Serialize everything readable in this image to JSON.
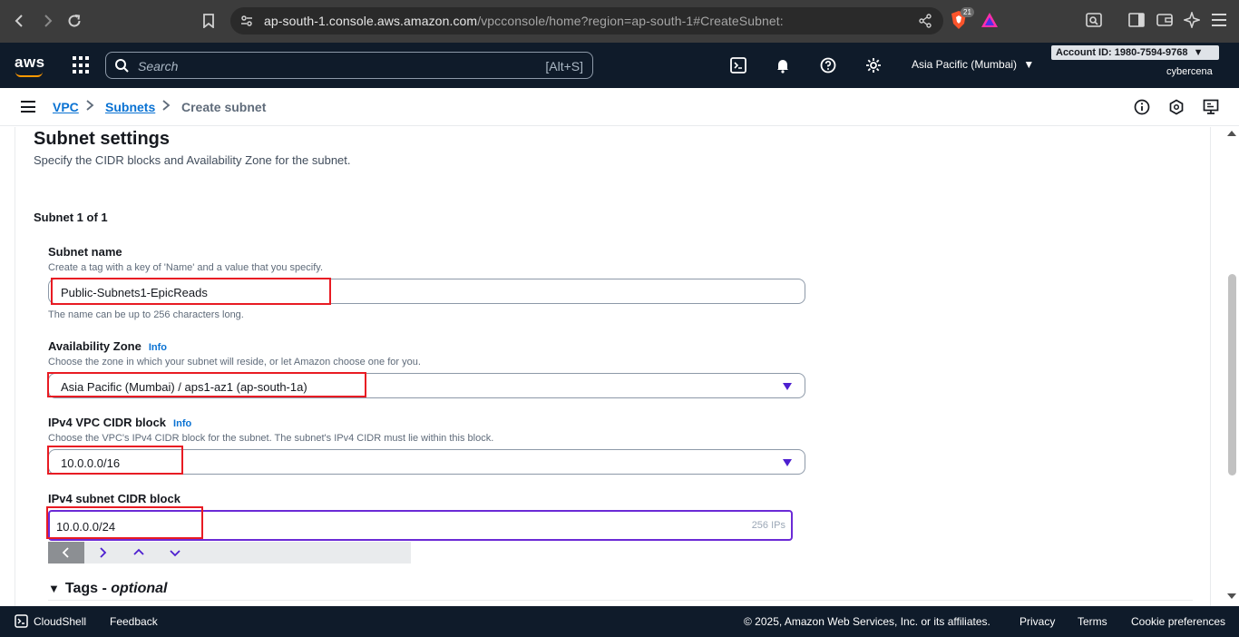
{
  "browser": {
    "url_main": "ap-south-1.console.aws.amazon.com",
    "url_rest": "/vpcconsole/home?region=ap-south-1#CreateSubnet:",
    "brave_badge": "21"
  },
  "aws_header": {
    "logo": "aws",
    "search_placeholder": "Search",
    "search_shortcut": "[Alt+S]",
    "region": "Asia Pacific (Mumbai)",
    "account_id": "Account ID: 1980-7594-9768",
    "username": "cybercena"
  },
  "breadcrumb": {
    "items": [
      "VPC",
      "Subnets"
    ],
    "current": "Create subnet"
  },
  "subnet_settings": {
    "title": "Subnet settings",
    "description": "Specify the CIDR blocks and Availability Zone for the subnet.",
    "subnet_count": "Subnet 1 of 1",
    "subnet_name": {
      "label": "Subnet name",
      "description": "Create a tag with a key of 'Name' and a value that you specify.",
      "value": "Public-Subnets1-EpicReads",
      "constraint": "The name can be up to 256 characters long."
    },
    "availability_zone": {
      "label": "Availability Zone",
      "info": "Info",
      "description": "Choose the zone in which your subnet will reside, or let Amazon choose one for you.",
      "value": "Asia Pacific (Mumbai) / aps1-az1 (ap-south-1a)"
    },
    "vpc_cidr": {
      "label": "IPv4 VPC CIDR block",
      "info": "Info",
      "description": "Choose the VPC's IPv4 CIDR block for the subnet. The subnet's IPv4 CIDR must lie within this block.",
      "value": "10.0.0.0/16"
    },
    "subnet_cidr": {
      "label": "IPv4 subnet CIDR block",
      "value": "10.0.0.0/24",
      "ips": "256 IPs"
    },
    "tags": {
      "label": "Tags - ",
      "optional": "optional"
    }
  },
  "footer": {
    "cloudshell": "CloudShell",
    "feedback": "Feedback",
    "copyright": "© 2025, Amazon Web Services, Inc. or its affiliates.",
    "privacy": "Privacy",
    "terms": "Terms",
    "cookies": "Cookie preferences"
  },
  "colors": {
    "highlight": "#e81b23",
    "link": "#0972d3",
    "accent": "#4d1fd0",
    "header_bg": "#0f1b2a"
  }
}
